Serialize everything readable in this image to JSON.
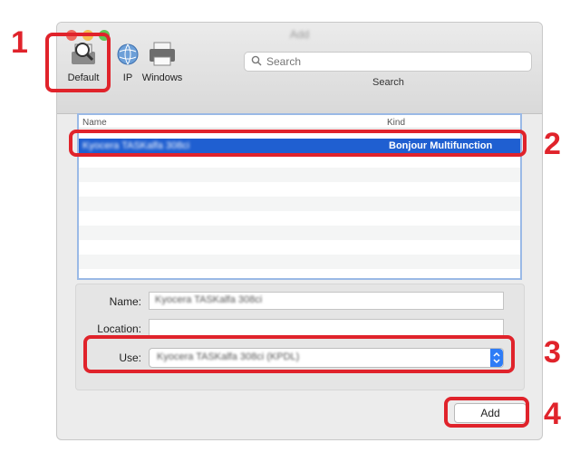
{
  "window": {
    "title": "Add"
  },
  "toolbar": {
    "default_label": "Default",
    "ip_label": "IP",
    "windows_label": "Windows",
    "search_placeholder": "Search",
    "search_label": "Search"
  },
  "list": {
    "header_name": "Name",
    "header_kind": "Kind",
    "rows": [
      {
        "name": "Kyocera TASKalfa 308ci",
        "kind": "Bonjour Multifunction"
      }
    ]
  },
  "form": {
    "name_label": "Name:",
    "name_value": "Kyocera TASKalfa 308ci",
    "location_label": "Location:",
    "location_value": "",
    "use_label": "Use:",
    "use_value": "Kyocera TASKalfa 308ci (KPDL)"
  },
  "add_button": "Add",
  "callouts": [
    "1",
    "2",
    "3",
    "4"
  ],
  "colors": {
    "accent": "#e0232b",
    "selection": "#1f5fd1",
    "stepper": "#2f7cf6"
  }
}
